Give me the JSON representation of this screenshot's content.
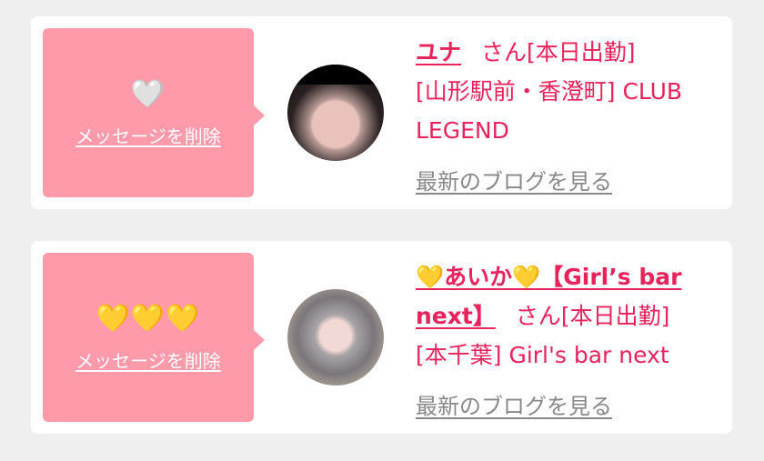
{
  "items": [
    {
      "hearts": "🤍",
      "delete_label": "メッセージを削除",
      "name": "ユナ",
      "suffix": "さん[本日出勤]",
      "shop": "[山形駅前・香澄町] CLUB LEGEND",
      "blog_label": "最新のブログを見る"
    },
    {
      "hearts": "💛💛💛",
      "delete_label": "メッセージを削除",
      "name": "💛あいか💛【Girl’s bar next】",
      "suffix": "さん[本日出勤]",
      "shop": "[本千葉] Girl's bar next",
      "blog_label": "最新のブログを見る"
    }
  ],
  "colors": {
    "background": "#efefef",
    "card": "#ffffff",
    "message_box": "#ff9aaa",
    "accent": "#e8225a",
    "link_gray": "#888888"
  }
}
